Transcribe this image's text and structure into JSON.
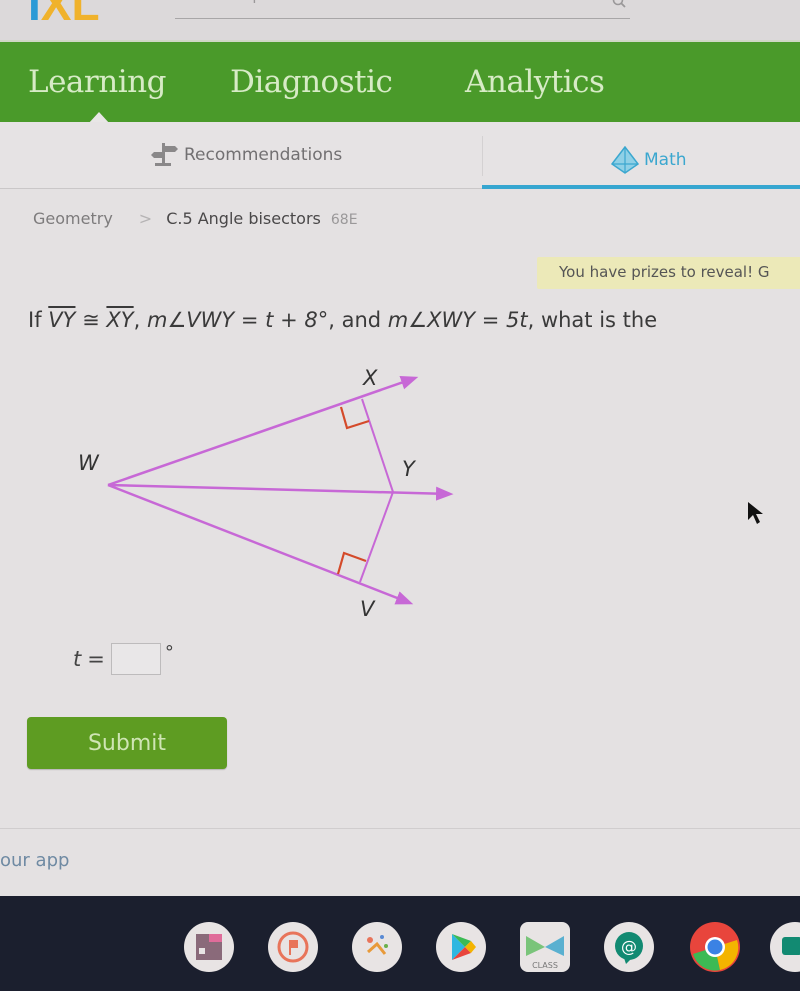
{
  "header": {
    "logo_i": "I",
    "logo_xl": "XL",
    "search_placeholder": "Search topics and skills",
    "search_icon": "search-icon"
  },
  "nav": {
    "items": [
      {
        "label": "Learning",
        "active": true
      },
      {
        "label": "Diagnostic",
        "active": false
      },
      {
        "label": "Analytics",
        "active": false
      }
    ]
  },
  "subtabs": {
    "recommendations": {
      "label": "Recommendations",
      "icon": "recommendations-icon"
    },
    "math": {
      "label": "Math",
      "icon": "pyramid-icon",
      "active": true
    }
  },
  "breadcrumb": {
    "subject": "Geometry",
    "separator": ">",
    "skill": "C.5 Angle bisectors",
    "code": "68E"
  },
  "prize_banner": "You have prizes to reveal! G",
  "question": {
    "p1": "If ",
    "seg1": "VY",
    "p2": " ≅ ",
    "seg2": "XY",
    "p3": ", ",
    "expr1": "m∠VWY = t + 8°",
    "p4": ", and ",
    "expr2": "m∠XWY = 5t",
    "p5": ", what is the"
  },
  "diagram": {
    "labels": {
      "X": "X",
      "Y": "Y",
      "W": "W",
      "V": "V"
    },
    "line_color": "#c768d6",
    "right_angle_color": "#d44a2a"
  },
  "answer": {
    "variable": "t",
    "equals": "=",
    "value": "",
    "unit": "°"
  },
  "submit_label": "Submit",
  "footer_text": "our app",
  "colors": {
    "nav_green": "#4a9a2a",
    "submit_green": "#5e9c22",
    "math_blue": "#36a6d0",
    "prize_yellow": "#ece9b8"
  },
  "taskbar": {
    "apps": [
      "qr-app-icon",
      "flag-app-icon",
      "paint-app-icon",
      "play-store-icon",
      "class-app-icon",
      "chat-app-icon",
      "chrome-icon",
      "meet-icon"
    ],
    "class_label": "CLASS"
  }
}
